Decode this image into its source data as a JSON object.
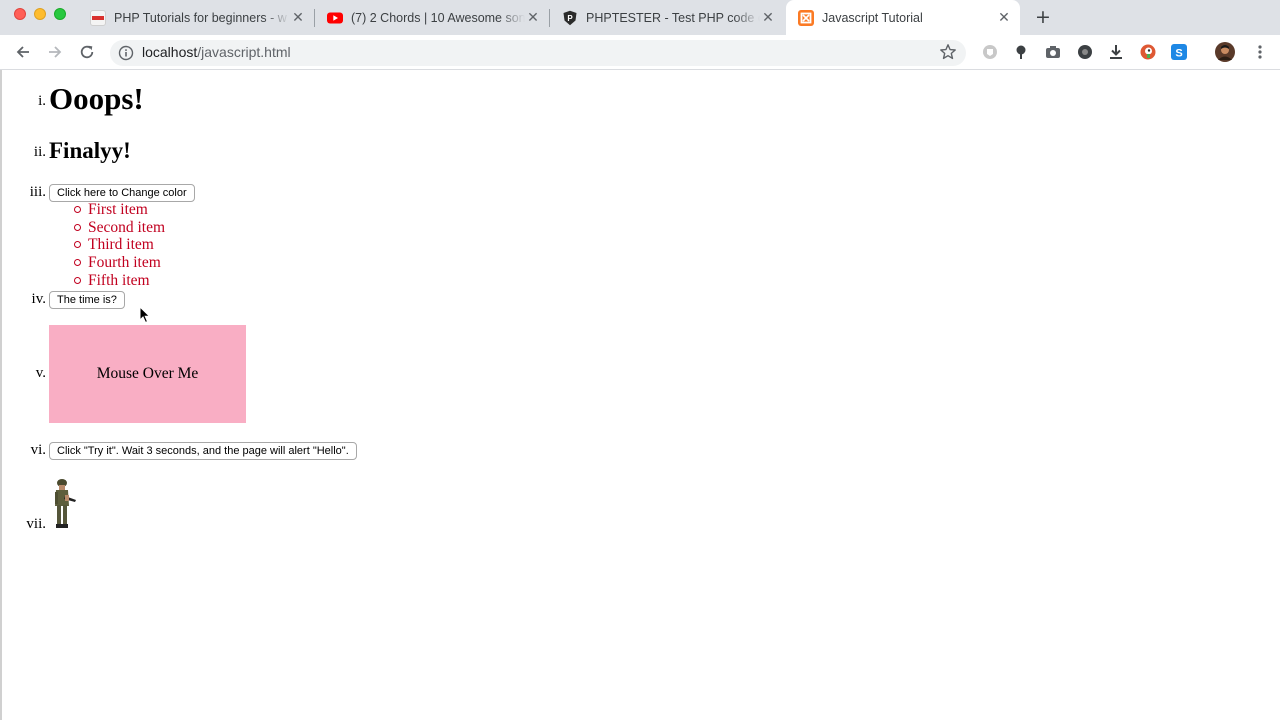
{
  "browser": {
    "tabs": [
      {
        "title": "PHP Tutorials for beginners - w",
        "active": false
      },
      {
        "title": "(7) 2 Chords | 10 Awesome son",
        "active": false
      },
      {
        "title": "PHPTESTER - Test PHP code o",
        "active": false
      },
      {
        "title": "Javascript Tutorial",
        "active": true
      }
    ],
    "tab_close": "✕",
    "new_tab": "+",
    "address": {
      "host": "localhost",
      "path": "/javascript.html"
    }
  },
  "page": {
    "markers": [
      "i.",
      "ii.",
      "iii.",
      "iv.",
      "v.",
      "vi.",
      "vii."
    ],
    "heading1": "Ooops!",
    "heading2": "Finalyy!",
    "change_color_button": "Click here to Change color",
    "items": [
      "First item",
      "Second item",
      "Third item",
      "Fourth item",
      "Fifth item"
    ],
    "time_button": "The time is?",
    "mouse_over_text": "Mouse Over Me",
    "try_it_button": "Click \"Try it\". Wait 3 seconds, and the page will alert \"Hello\"."
  },
  "colors": {
    "list_text": "#c1001f",
    "mouse_box": "#f9aec4"
  }
}
